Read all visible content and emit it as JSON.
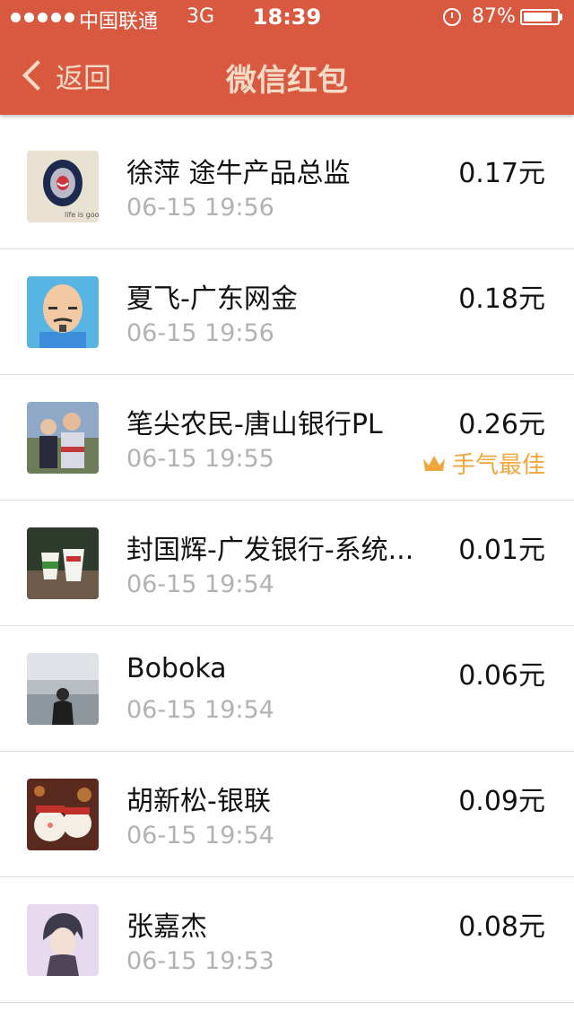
{
  "status": {
    "carrier": "中国联通",
    "network": "3G",
    "time": "18:39",
    "battery": "87%",
    "battery_level": 0.87
  },
  "nav": {
    "back_label": "返回",
    "title": "微信红包"
  },
  "records": [
    {
      "name": "徐萍 途牛产品总监",
      "time": "06-15 19:56",
      "amount": "0.17元",
      "best": ""
    },
    {
      "name": "夏飞-广东网金",
      "time": "06-15 19:56",
      "amount": "0.18元",
      "best": ""
    },
    {
      "name": "笔尖农民-唐山银行PL",
      "time": "06-15 19:55",
      "amount": "0.26元",
      "best": "手气最佳"
    },
    {
      "name": "封国辉-广发银行-系统...",
      "time": "06-15 19:54",
      "amount": "0.01元",
      "best": ""
    },
    {
      "name": "Boboka",
      "time": "06-15 19:54",
      "amount": "0.06元",
      "best": ""
    },
    {
      "name": "胡新松-银联",
      "time": "06-15 19:54",
      "amount": "0.09元",
      "best": ""
    },
    {
      "name": "张嘉杰",
      "time": "06-15 19:53",
      "amount": "0.08元",
      "best": ""
    }
  ],
  "colors": {
    "header": "#d95940",
    "title_text": "#f6dcc7",
    "best_badge": "#f2a53a",
    "time_text": "#b2b2b2"
  }
}
